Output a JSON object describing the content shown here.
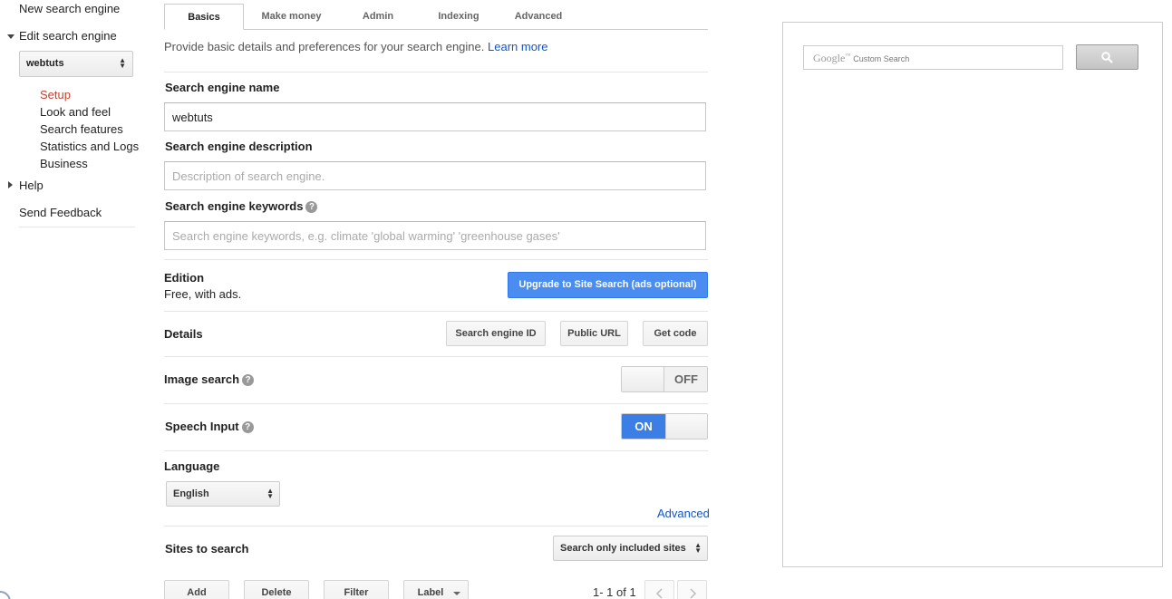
{
  "sidebar": {
    "new_engine": "New search engine",
    "edit_engine": "Edit search engine",
    "engine_select": "webtuts",
    "sub_items": [
      {
        "label": "Setup"
      },
      {
        "label": "Look and feel"
      },
      {
        "label": "Search features"
      },
      {
        "label": "Statistics and Logs"
      },
      {
        "label": "Business"
      }
    ],
    "help": "Help",
    "send_feedback": "Send Feedback"
  },
  "tabs": [
    {
      "label": "Basics"
    },
    {
      "label": "Make money"
    },
    {
      "label": "Admin"
    },
    {
      "label": "Indexing"
    },
    {
      "label": "Advanced"
    }
  ],
  "intro": {
    "text": "Provide basic details and preferences for your search engine.",
    "learn_more": "Learn more"
  },
  "form": {
    "name_label": "Search engine name",
    "name_value": "webtuts",
    "description_label": "Search engine description",
    "description_placeholder": "Description of search engine.",
    "keywords_label": "Search engine keywords",
    "keywords_placeholder": "Search engine keywords, e.g. climate 'global warming' 'greenhouse gases'"
  },
  "edition": {
    "label": "Edition",
    "value": "Free, with ads.",
    "upgrade_button": "Upgrade to Site Search (ads optional)"
  },
  "details": {
    "label": "Details",
    "buttons": [
      "Search engine ID",
      "Public URL",
      "Get code"
    ]
  },
  "image_search": {
    "label": "Image search",
    "state": "OFF"
  },
  "speech_input": {
    "label": "Speech Input",
    "state": "ON"
  },
  "language": {
    "label": "Language",
    "value": "English",
    "advanced_link": "Advanced"
  },
  "sites": {
    "label": "Sites to search",
    "select_value": "Search only included sites",
    "actions": [
      "Add",
      "Delete",
      "Filter",
      "Label"
    ],
    "pager": "1- 1 of 1"
  },
  "preview": {
    "brand": "Google",
    "brand_suffix": "Custom Search"
  },
  "colors": {
    "accent_blue": "#4a8cf0",
    "link": "#1155cc",
    "active_red": "#c8402f"
  }
}
